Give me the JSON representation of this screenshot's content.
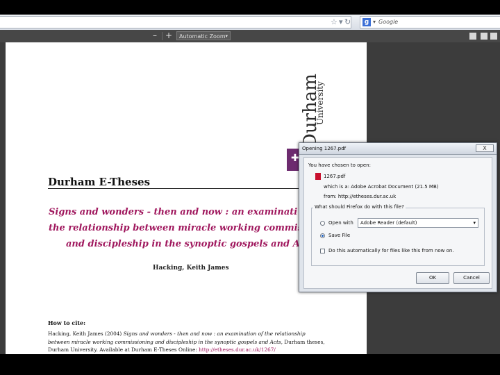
{
  "browser": {
    "search_engine": "Google",
    "icons": {
      "bookmark": "star-icon",
      "reload": "reload-icon",
      "dropdown": "dropdown-icon",
      "search_logo": "google-icon"
    }
  },
  "pdf_toolbar": {
    "zoom_out": "–",
    "zoom_in": "+",
    "zoom_level": "Automatic Zoom"
  },
  "document": {
    "logo_line1": "Durham",
    "logo_line2": "University",
    "repository_title": "Durham E-Theses",
    "thesis_title_lines": [
      "Signs and wonders - then and now : an examinati",
      "the relationship between miracle working commissio",
      "and discipleship in the synoptic gospels and Act"
    ],
    "author": "Hacking, Keith James",
    "how_to_cite_heading": "How to cite:",
    "citation_prefix": "Hacking, Keith James (2004) ",
    "citation_italic1": "Signs and wonders - then and now : an examination of the relationship",
    "citation_line2": "between miracle working commissioning and discipleship in the synoptic gospels and Acts,",
    "citation_line2_tail": " Durham theses,",
    "citation_line3": "Durham University. Available at Durham E-Theses Online: ",
    "citation_link": "http://etheses.dur.ac.uk/1267/"
  },
  "dialog": {
    "title": "Opening 1267.pdf",
    "close_label": "X",
    "chosen_to_open": "You have chosen to open:",
    "filename": "1267.pdf",
    "file_type": "which is a: Adobe Acrobat Document (21.5 MB)",
    "source": "from: http://etheses.dur.ac.uk",
    "question": "What should Firefox do with this file?",
    "open_with_label": "Open with",
    "open_with_app": "Adobe Reader (default)",
    "save_file_label": "Save File",
    "auto_checkbox_label": "Do this automatically for files like this from now on.",
    "selected_option": "Save File",
    "ok_label": "OK",
    "cancel_label": "Cancel"
  }
}
